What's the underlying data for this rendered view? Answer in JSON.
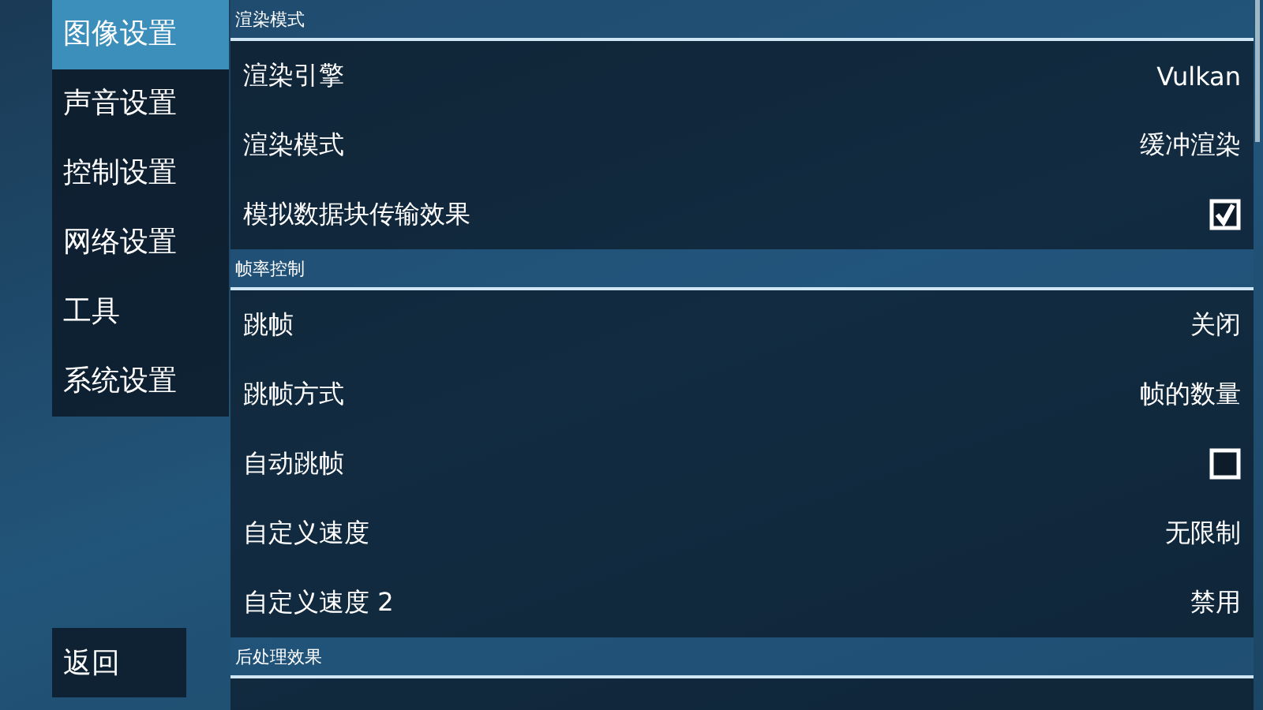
{
  "sidebar": {
    "items": [
      {
        "label": "图像设置",
        "selected": true
      },
      {
        "label": "声音设置",
        "selected": false
      },
      {
        "label": "控制设置",
        "selected": false
      },
      {
        "label": "网络设置",
        "selected": false
      },
      {
        "label": "工具",
        "selected": false
      },
      {
        "label": "系统设置",
        "selected": false
      }
    ],
    "back_button": "返回"
  },
  "sections": [
    {
      "title": "渲染模式",
      "rows": [
        {
          "kind": "value",
          "label": "渲染引擎",
          "value": "Vulkan"
        },
        {
          "kind": "value",
          "label": "渲染模式",
          "value": "缓冲渲染"
        },
        {
          "kind": "checkbox",
          "label": "模拟数据块传输效果",
          "checked": true
        }
      ]
    },
    {
      "title": "帧率控制",
      "rows": [
        {
          "kind": "value",
          "label": "跳帧",
          "value": "关闭"
        },
        {
          "kind": "value",
          "label": "跳帧方式",
          "value": "帧的数量"
        },
        {
          "kind": "checkbox",
          "label": "自动跳帧",
          "checked": false
        },
        {
          "kind": "value",
          "label": "自定义速度",
          "value": "无限制"
        },
        {
          "kind": "value",
          "label": "自定义速度 2",
          "value": "禁用"
        }
      ]
    },
    {
      "title": "后处理效果"
    }
  ]
}
